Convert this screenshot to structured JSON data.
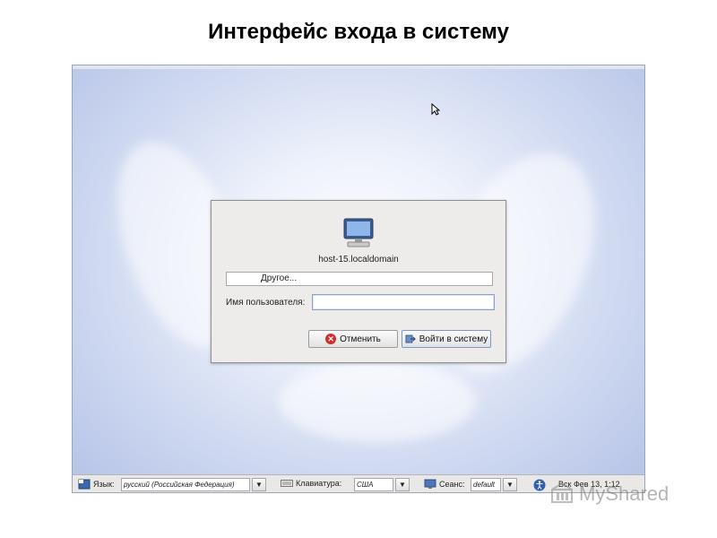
{
  "slide": {
    "title": "Интерфейс входа в систему"
  },
  "login": {
    "hostname": "host-15.localdomain",
    "other_label": "Другое...",
    "username_label": "Имя пользователя:",
    "username_value": "",
    "cancel_label": "Отменить",
    "login_label": "Войти в систему"
  },
  "taskbar": {
    "language_label": "Язык:",
    "language_value": "русский (Российская Федерация)",
    "keyboard_label": "Клавиатура:",
    "keyboard_value": "США",
    "session_label": "Сеанс:",
    "session_value": "default",
    "clock": "Вск Фев 13,  1:12"
  },
  "watermark": {
    "text": "MyShared"
  },
  "icons": {
    "computer": "computer-icon",
    "cancel": "cancel-icon",
    "login": "login-icon",
    "language": "language-icon",
    "keyboard": "keyboard-icon",
    "session": "session-icon",
    "accessibility": "accessibility-icon",
    "cursor": "cursor-icon"
  },
  "colors": {
    "accent": "#7b98c9",
    "cancel_red": "#d62b2b",
    "background": "#d3dcf2"
  }
}
